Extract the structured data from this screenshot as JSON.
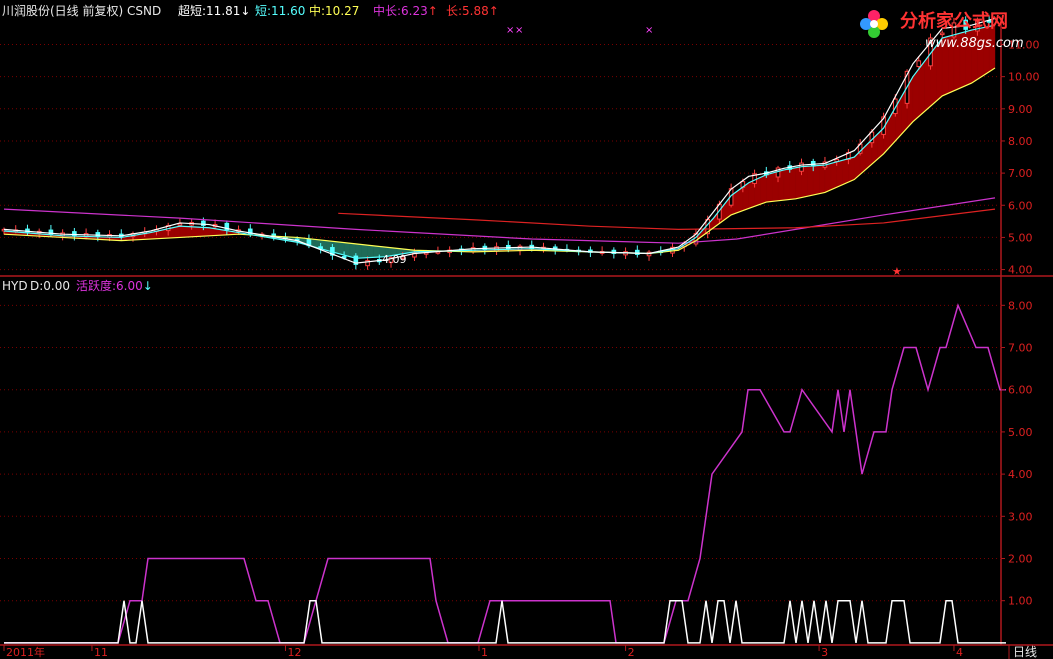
{
  "stock_header": {
    "name": "川润股份(日线 前复权) CSND",
    "chaoduan_label": "超短:",
    "chaoduan_value": "11.81",
    "chaoduan_arrow": "↓",
    "duan_label": "短:",
    "duan_value": "11.60",
    "zhong_label": "中:",
    "zhong_value": "10.27",
    "zhongchang_label": "中长:",
    "zhongchang_value": "6.23",
    "zhongchang_arrow": "↑",
    "chang_label": "长:",
    "chang_value": "5.88",
    "chang_arrow": "↑"
  },
  "indicator_header": {
    "name": "HYD",
    "d_label": "D:",
    "d_value": "0.00",
    "hyd_label": "活跃度:",
    "hyd_value": "6.00",
    "hyd_arrow": "↓"
  },
  "logo": {
    "text": "分析家公式网",
    "url": "www.88gs.com"
  },
  "timeframe_label": "日线",
  "low_price_label": "4.09",
  "colors": {
    "background": "#000000",
    "axis_red": "#b0191e",
    "grid": "#7a0000",
    "price_label": "#dd2020",
    "hyd_line": "#cc33cc",
    "d_line": "#ffffff",
    "ma_chaoduan": "#ffffff",
    "ma_zhong": "#ffff55",
    "ma_zhongchang": "#cc33cc",
    "ma_chang": "#dd2222",
    "fill_up": "#9b0000",
    "fill_down": "#1f6b58",
    "candle_up": "#ff4040",
    "candle_down": "#55ffff"
  },
  "chart_data": [
    {
      "type": "candlestick",
      "title": "川润股份(日线 前复权) CSND",
      "y_ticks": [
        "4.00",
        "5.00",
        "6.00",
        "7.00",
        "8.00",
        "9.00",
        "10.00",
        "11.00"
      ],
      "ylim": [
        3.8,
        11.7
      ],
      "x_ticks": [
        "2011年",
        "11",
        "12",
        "1",
        "2",
        "3",
        "4"
      ],
      "x_tick_index": [
        0,
        15,
        48,
        81,
        106,
        139,
        162
      ],
      "count": 170,
      "series": [
        {
          "name": "中长",
          "color": "#cc33cc",
          "x": [
            0,
            30,
            60,
            90,
            115,
            125,
            135,
            150,
            169
          ],
          "y": [
            5.88,
            5.6,
            5.25,
            4.95,
            4.82,
            4.95,
            5.25,
            5.7,
            6.23
          ]
        },
        {
          "name": "长",
          "color": "#dd2222",
          "x": [
            57,
            80,
            100,
            115,
            135,
            150,
            169
          ],
          "y": [
            5.75,
            5.55,
            5.35,
            5.25,
            5.3,
            5.45,
            5.88
          ]
        },
        {
          "name": "中",
          "x": [
            0,
            10,
            20,
            30,
            40,
            50,
            60,
            70,
            80,
            90,
            100,
            110,
            115,
            118,
            121,
            124,
            127,
            130,
            135,
            140,
            145,
            150,
            155,
            160,
            165,
            169
          ],
          "y": [
            5.1,
            5.0,
            4.9,
            5.0,
            5.1,
            5.0,
            4.8,
            4.6,
            4.55,
            4.6,
            4.55,
            4.5,
            4.6,
            4.9,
            5.3,
            5.7,
            5.9,
            6.1,
            6.2,
            6.4,
            6.8,
            7.6,
            8.6,
            9.4,
            9.8,
            10.27
          ]
        },
        {
          "name": "短",
          "x": [
            0,
            10,
            20,
            25,
            30,
            35,
            40,
            50,
            55,
            60,
            65,
            70,
            80,
            90,
            100,
            110,
            115,
            118,
            121,
            124,
            127,
            130,
            133,
            136,
            140,
            145,
            150,
            155,
            160,
            165,
            169
          ],
          "y": [
            5.2,
            5.05,
            5.0,
            5.15,
            5.35,
            5.3,
            5.15,
            4.85,
            4.6,
            4.35,
            4.4,
            4.55,
            4.6,
            4.65,
            4.55,
            4.5,
            4.65,
            5.0,
            5.6,
            6.3,
            6.7,
            6.95,
            7.1,
            7.2,
            7.25,
            7.5,
            8.4,
            10.0,
            11.2,
            11.45,
            11.6
          ]
        },
        {
          "name": "超短",
          "x": [
            0,
            10,
            20,
            25,
            30,
            35,
            40,
            50,
            55,
            60,
            65,
            70,
            80,
            90,
            100,
            110,
            115,
            118,
            121,
            124,
            127,
            130,
            133,
            136,
            140,
            145,
            150,
            155,
            160,
            165,
            169
          ],
          "y": [
            5.25,
            5.1,
            5.05,
            5.2,
            5.45,
            5.4,
            5.2,
            4.9,
            4.55,
            4.2,
            4.3,
            4.5,
            4.65,
            4.7,
            4.55,
            4.5,
            4.7,
            5.1,
            5.8,
            6.5,
            6.9,
            7.0,
            7.15,
            7.25,
            7.3,
            7.7,
            8.7,
            10.4,
            11.5,
            11.6,
            11.81
          ]
        }
      ],
      "annotation": {
        "text": "4.09",
        "x": 63,
        "y": 4.09
      }
    },
    {
      "type": "line",
      "title": "HYD",
      "y_ticks": [
        "1.00",
        "2.00",
        "3.00",
        "4.00",
        "5.00",
        "6.00",
        "7.00",
        "8.00"
      ],
      "ylim": [
        -0.05,
        8.6
      ],
      "series": [
        {
          "name": "活跃度",
          "color": "#cc33cc",
          "x": [
            0,
            19,
            21,
            23,
            24,
            26,
            40,
            42,
            44,
            46,
            47,
            50,
            52,
            54,
            71,
            72,
            74,
            76,
            79,
            81,
            101,
            102,
            104,
            106,
            110,
            112,
            114,
            116,
            117,
            118,
            123,
            124,
            126,
            130,
            131,
            133,
            138,
            139,
            140,
            141,
            142,
            143,
            145,
            147,
            148,
            150,
            152,
            154,
            156,
            157,
            159,
            162,
            164,
            166,
            167
          ],
          "y": [
            0,
            0,
            1,
            1,
            2,
            2,
            2,
            1,
            1,
            0,
            0,
            0,
            1,
            2,
            2,
            1,
            0,
            0,
            0,
            1,
            1,
            0,
            0,
            0,
            0,
            1,
            1,
            2,
            3,
            4,
            5,
            6,
            6,
            5,
            5,
            6,
            5,
            6,
            5,
            6,
            5,
            4,
            5,
            5,
            6,
            7,
            7,
            6,
            7,
            7,
            8,
            7,
            7,
            6,
            6
          ]
        },
        {
          "name": "D",
          "color": "#ffffff",
          "x": [
            0,
            19,
            20,
            21,
            22,
            23,
            24,
            25,
            26,
            27,
            50,
            51,
            52,
            53,
            54,
            82,
            83,
            84,
            85,
            86,
            110,
            111,
            112,
            113,
            114,
            115,
            116,
            117,
            118,
            119,
            120,
            121,
            122,
            123,
            124,
            125,
            126,
            127,
            128,
            130,
            131,
            132,
            133,
            134,
            135,
            136,
            137,
            138,
            139,
            140,
            141,
            142,
            143,
            144,
            145,
            146,
            147,
            148,
            149,
            150,
            151,
            152,
            153,
            154,
            155,
            156,
            157,
            158,
            159,
            160,
            161,
            162,
            163,
            164,
            165,
            166,
            167
          ],
          "y": [
            0,
            0,
            1,
            0,
            0,
            1,
            0,
            0,
            0,
            0,
            0,
            1,
            1,
            0,
            0,
            0,
            1,
            0,
            0,
            0,
            0,
            1,
            1,
            1,
            0,
            0,
            0,
            1,
            0,
            1,
            1,
            0,
            1,
            0,
            0,
            0,
            0,
            0,
            0,
            0,
            1,
            0,
            1,
            0,
            1,
            0,
            1,
            0,
            1,
            1,
            1,
            0,
            1,
            0,
            0,
            0,
            0,
            1,
            1,
            1,
            0,
            0,
            0,
            0,
            0,
            0,
            1,
            1,
            0,
            0,
            0,
            0,
            0,
            0,
            0,
            0,
            0
          ]
        }
      ]
    }
  ]
}
